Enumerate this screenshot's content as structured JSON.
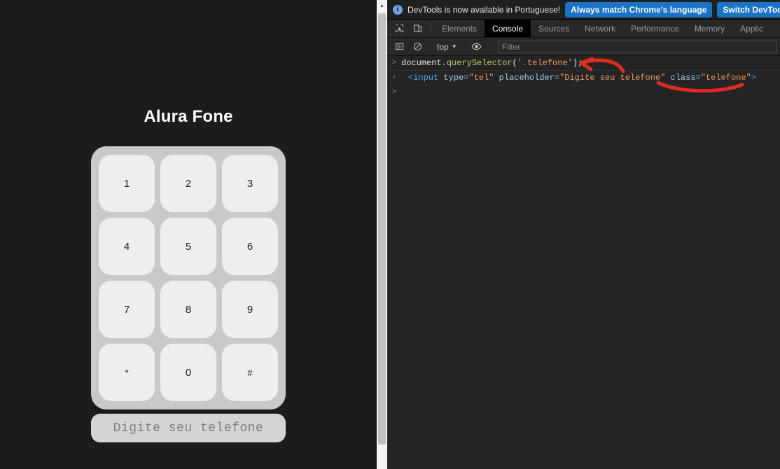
{
  "webpage": {
    "title": "Alura Fone",
    "keys": [
      "1",
      "2",
      "3",
      "4",
      "5",
      "6",
      "7",
      "8",
      "9",
      "*",
      "0",
      "#"
    ],
    "input": {
      "placeholder": "Digite seu telefone",
      "value": ""
    },
    "colors": {
      "background": "#1c1c1c",
      "keypad": "#c9c9c9",
      "key": "#eeeeee",
      "input": "#d4d4d4"
    }
  },
  "devtools": {
    "banner": {
      "icon": "info-icon",
      "message": "DevTools is now available in Portuguese!",
      "primary_button": "Always match Chrome's language",
      "secondary_button": "Switch DevTools to"
    },
    "toolbar_icons": [
      {
        "name": "inspect-element-icon"
      },
      {
        "name": "device-toolbar-icon"
      }
    ],
    "tabs": [
      {
        "label": "Elements",
        "active": false
      },
      {
        "label": "Console",
        "active": true
      },
      {
        "label": "Sources",
        "active": false
      },
      {
        "label": "Network",
        "active": false
      },
      {
        "label": "Performance",
        "active": false
      },
      {
        "label": "Memory",
        "active": false
      },
      {
        "label": "Applic",
        "active": false
      }
    ],
    "filterbar": {
      "sidebar_icon": "console-sidebar-icon",
      "clear_icon": "clear-console-icon",
      "context": "top",
      "eye_icon": "live-expression-icon",
      "filter_placeholder": "Filter",
      "filter_value": ""
    },
    "console": {
      "rows": [
        {
          "gutter": ">",
          "type": "input",
          "tokens": [
            {
              "t": "document",
              "c": "tok-plain"
            },
            {
              "t": ".",
              "c": "tok-punc"
            },
            {
              "t": "querySelector",
              "c": "tok-fn"
            },
            {
              "t": "(",
              "c": "tok-punc"
            },
            {
              "t": "'.telefone'",
              "c": "tok-str"
            },
            {
              "t": ");",
              "c": "tok-punc"
            }
          ]
        },
        {
          "gutter": "‹",
          "type": "output",
          "tokens": [
            {
              "t": "<input",
              "c": "tok-tag"
            },
            {
              "t": " ",
              "c": "tok-plain"
            },
            {
              "t": "type=",
              "c": "tok-attr"
            },
            {
              "t": "\"tel\"",
              "c": "tok-str"
            },
            {
              "t": " ",
              "c": "tok-plain"
            },
            {
              "t": "placeholder=",
              "c": "tok-attr"
            },
            {
              "t": "\"Digite seu telefone\"",
              "c": "tok-str"
            },
            {
              "t": " ",
              "c": "tok-plain"
            },
            {
              "t": "class=",
              "c": "tok-attr"
            },
            {
              "t": "\"telefone\"",
              "c": "tok-str"
            },
            {
              "t": ">",
              "c": "tok-tag"
            }
          ]
        },
        {
          "gutter": ">",
          "type": "prompt",
          "tokens": []
        }
      ]
    },
    "annotations": [
      {
        "name": "red-arrow-annotation",
        "color": "#e02b20"
      },
      {
        "name": "red-underline-annotation",
        "color": "#e02b20"
      }
    ]
  }
}
